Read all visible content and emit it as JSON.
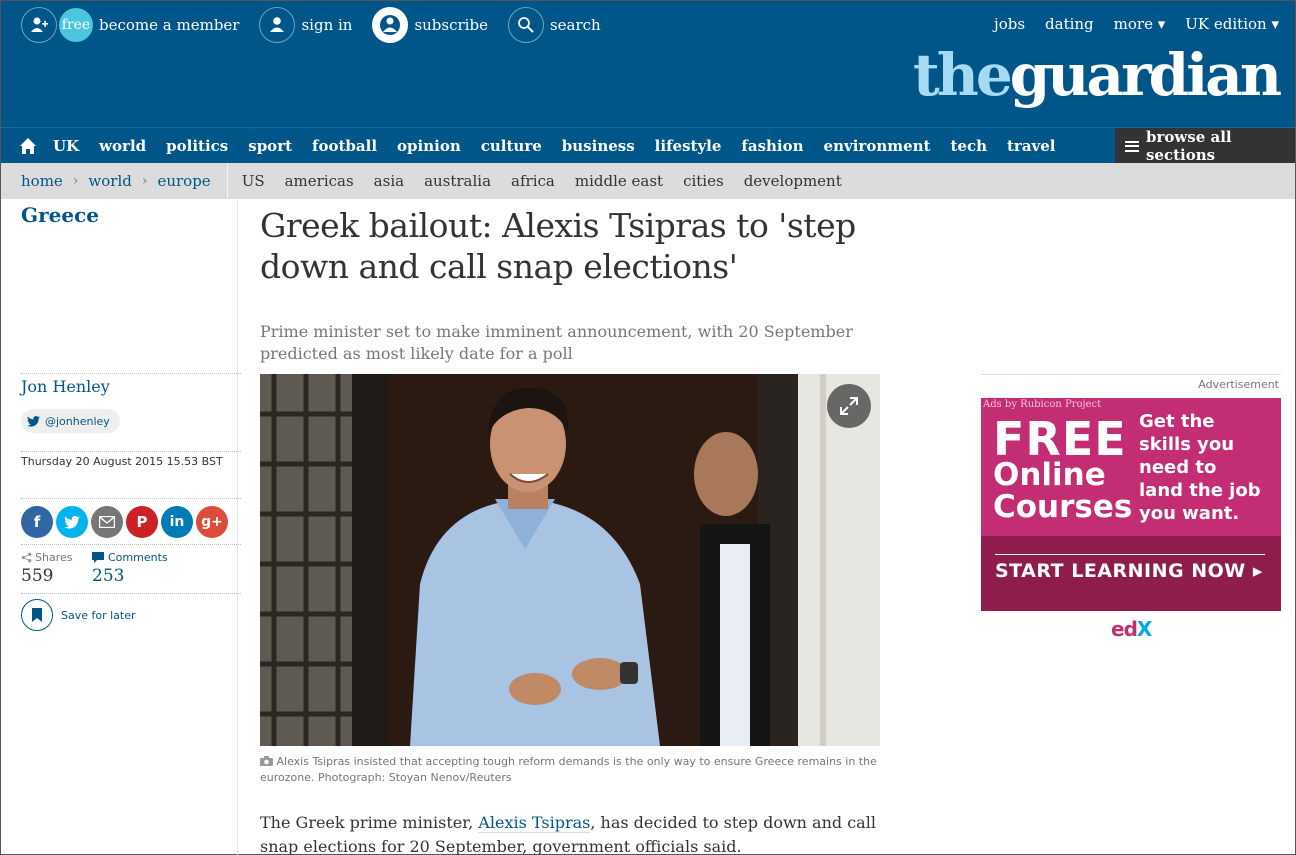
{
  "header": {
    "links": [
      {
        "label": "become a member",
        "badge": "free"
      },
      {
        "label": "sign in"
      },
      {
        "label": "subscribe"
      },
      {
        "label": "search"
      }
    ],
    "right": [
      "jobs",
      "dating",
      "more ▾",
      "UK edition ▾"
    ],
    "logo_the": "the",
    "logo_guardian": "guardian"
  },
  "nav": {
    "items": [
      "UK",
      "world",
      "politics",
      "sport",
      "football",
      "opinion",
      "culture",
      "business",
      "lifestyle",
      "fashion",
      "environment",
      "tech",
      "travel"
    ],
    "browse": "browse all sections"
  },
  "subnav": {
    "breadcrumbs": [
      "home",
      "world",
      "europe"
    ],
    "items": [
      "US",
      "americas",
      "asia",
      "australia",
      "africa",
      "middle east",
      "cities",
      "development"
    ]
  },
  "article": {
    "section": "Greece",
    "headline": "Greek bailout: Alexis Tsipras to 'step down and call snap elections'",
    "standfirst": "Prime minister set to make imminent announcement, with 20 September predicted as most likely date for a poll",
    "author": "Jon Henley",
    "twitter": "@jonhenley",
    "date": "Thursday 20 August 2015 15.53 BST",
    "shares_label": "Shares",
    "shares_count": "559",
    "comments_label": "Comments",
    "comments_count": "253",
    "save_label": "Save for later",
    "caption": "Alexis Tsipras insisted that accepting tough reform demands is the only way to ensure Greece remains in the eurozone. Photograph: Stoyan Nenov/Reuters",
    "body_before": "The Greek prime minister, ",
    "body_link": "Alexis Tsipras",
    "body_after": ", has decided to step down and call snap elections for 20 September, government officials said."
  },
  "social": [
    {
      "name": "facebook",
      "glyph": "f",
      "color": "#3067a3"
    },
    {
      "name": "twitter",
      "glyph": "",
      "color": "#03b3ee"
    },
    {
      "name": "email",
      "glyph": "",
      "color": "#767676"
    },
    {
      "name": "pinterest",
      "glyph": "P",
      "color": "#cc2127"
    },
    {
      "name": "linkedin",
      "glyph": "in",
      "color": "#007bb6"
    },
    {
      "name": "googleplus",
      "glyph": "g+",
      "color": "#dd4b39"
    }
  ],
  "ad": {
    "label": "Advertisement",
    "rubicon": "Ads by Rubicon Project",
    "free": "FREE",
    "online": "Online",
    "courses": "Courses",
    "side": [
      "Get the",
      "skills you",
      "need to",
      "land the job",
      "you want."
    ],
    "cta": "START LEARNING NOW ▸",
    "logo_ed": "ed",
    "logo_x": "X"
  }
}
